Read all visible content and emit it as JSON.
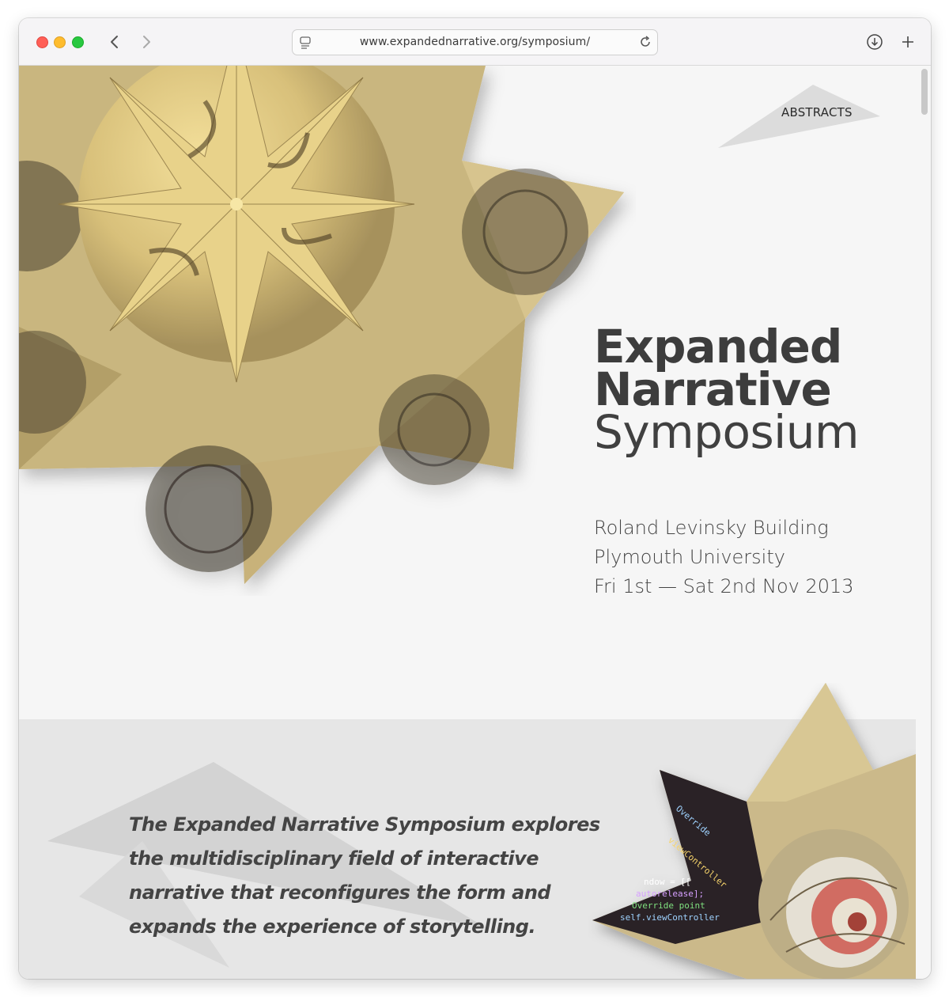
{
  "browser": {
    "url": "www.expandednarrative.org/symposium/"
  },
  "nav": {
    "abstracts_label": "ABSTRACTS"
  },
  "hero": {
    "title_line1": "Expanded",
    "title_line2": "Narrative",
    "title_line3": "Symposium",
    "venue_line1": "Roland Levinsky Building",
    "venue_line2": "Plymouth University",
    "venue_line3": "Fri 1st — Sat 2nd Nov 2013"
  },
  "intro": {
    "line1": "The Expanded Narrative Symposium explores",
    "line2": "the multidisciplinary field of interactive",
    "line3": "narrative that reconfigures the form and",
    "line4": "expands the experience of storytelling."
  },
  "colors": {
    "paper": "#d9c48a",
    "paper_dark": "#8a7748",
    "code_bg": "#2a2226",
    "band": "#e6e6e6",
    "text": "#3d3d3d"
  }
}
